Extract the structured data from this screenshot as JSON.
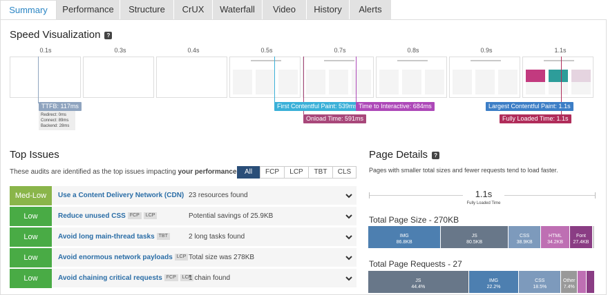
{
  "tabs": [
    {
      "label": "Summary",
      "active": true
    },
    {
      "label": "Performance"
    },
    {
      "label": "Structure"
    },
    {
      "label": "CrUX"
    },
    {
      "label": "Waterfall"
    },
    {
      "label": "Video"
    },
    {
      "label": "History"
    },
    {
      "label": "Alerts"
    }
  ],
  "speed": {
    "title": "Speed Visualization",
    "ticks": [
      "0.1s",
      "0.3s",
      "0.4s",
      "0.5s",
      "0.7s",
      "0.8s",
      "0.9s",
      "1.1s"
    ],
    "markers": {
      "ttfb": "TTFB: 117ms",
      "redirect": "Redirect: 0ms",
      "connect": "Connect: 89ms",
      "backend": "Backend: 28ms",
      "fcp": "First Contentful Paint: 539ms",
      "onload": "Onload Time: 591ms",
      "tti": "Time to Interactive: 684ms",
      "lcp": "Largest Contentful Paint: 1.1s",
      "fully": "Fully Loaded Time: 1.1s"
    },
    "colors": {
      "ttfb": "#8fa4bf",
      "fcp": "#3ab0d8",
      "onload": "#a8477a",
      "tti": "#ad48b8",
      "lcp": "#3c7ec6",
      "fully": "#b02c5a"
    }
  },
  "issues": {
    "title": "Top Issues",
    "desc_prefix": "These audits are identified as the top issues impacting ",
    "desc_bold": "your performance",
    "filters": [
      "All",
      "FCP",
      "LCP",
      "TBT",
      "CLS"
    ],
    "rows": [
      {
        "severity": "Med-Low",
        "level": "medlow",
        "title": "Use a Content Delivery Network (CDN)",
        "tags": [],
        "detail": "23 resources found"
      },
      {
        "severity": "Low",
        "level": "low",
        "title": "Reduce unused CSS",
        "tags": [
          "FCP",
          "LCP"
        ],
        "detail": "Potential savings of 25.9KB"
      },
      {
        "severity": "Low",
        "level": "low",
        "title": "Avoid long main-thread tasks",
        "tags": [
          "TBT"
        ],
        "detail": "2 long tasks found"
      },
      {
        "severity": "Low",
        "level": "low",
        "title": "Avoid enormous network payloads",
        "tags": [
          "LCP"
        ],
        "detail": "Total size was 278KB"
      },
      {
        "severity": "Low",
        "level": "low",
        "title": "Avoid chaining critical requests",
        "tags": [
          "FCP",
          "LCP"
        ],
        "detail": "1 chain found"
      }
    ]
  },
  "details": {
    "title": "Page Details",
    "desc": "Pages with smaller total sizes and fewer requests tend to load faster.",
    "load_value": "1.1s",
    "load_label": "Fully Loaded Time",
    "size_title": "Total Page Size - 270KB",
    "size_segments": [
      {
        "name": "IMG",
        "value": "86.8KB",
        "share": 32.1,
        "color": "#4d7fb0"
      },
      {
        "name": "JS",
        "value": "80.5KB",
        "share": 29.8,
        "color": "#687789"
      },
      {
        "name": "CSS",
        "value": "38.9KB",
        "share": 14.4,
        "color": "#7d9abc"
      },
      {
        "name": "HTML",
        "value": "34.2KB",
        "share": 12.7,
        "color": "#be6fb3"
      },
      {
        "name": "Font",
        "value": "27.4KB",
        "share": 10.1,
        "color": "#8a3d84"
      },
      {
        "name": "",
        "value": "",
        "share": 0.9,
        "color": "#cfcfcf"
      }
    ],
    "req_title": "Total Page Requests - 27",
    "req_segments": [
      {
        "name": "JS",
        "value": "44.4%",
        "share": 44.4,
        "color": "#687789"
      },
      {
        "name": "IMG",
        "value": "22.2%",
        "share": 22.2,
        "color": "#4d7fb0"
      },
      {
        "name": "CSS",
        "value": "18.5%",
        "share": 18.5,
        "color": "#7d9abc"
      },
      {
        "name": "Other",
        "value": "7.4%",
        "share": 7.4,
        "color": "#999"
      },
      {
        "name": "",
        "value": "",
        "share": 3.8,
        "color": "#be6fb3"
      },
      {
        "name": "",
        "value": "",
        "share": 3.7,
        "color": "#8a3d84"
      }
    ]
  }
}
